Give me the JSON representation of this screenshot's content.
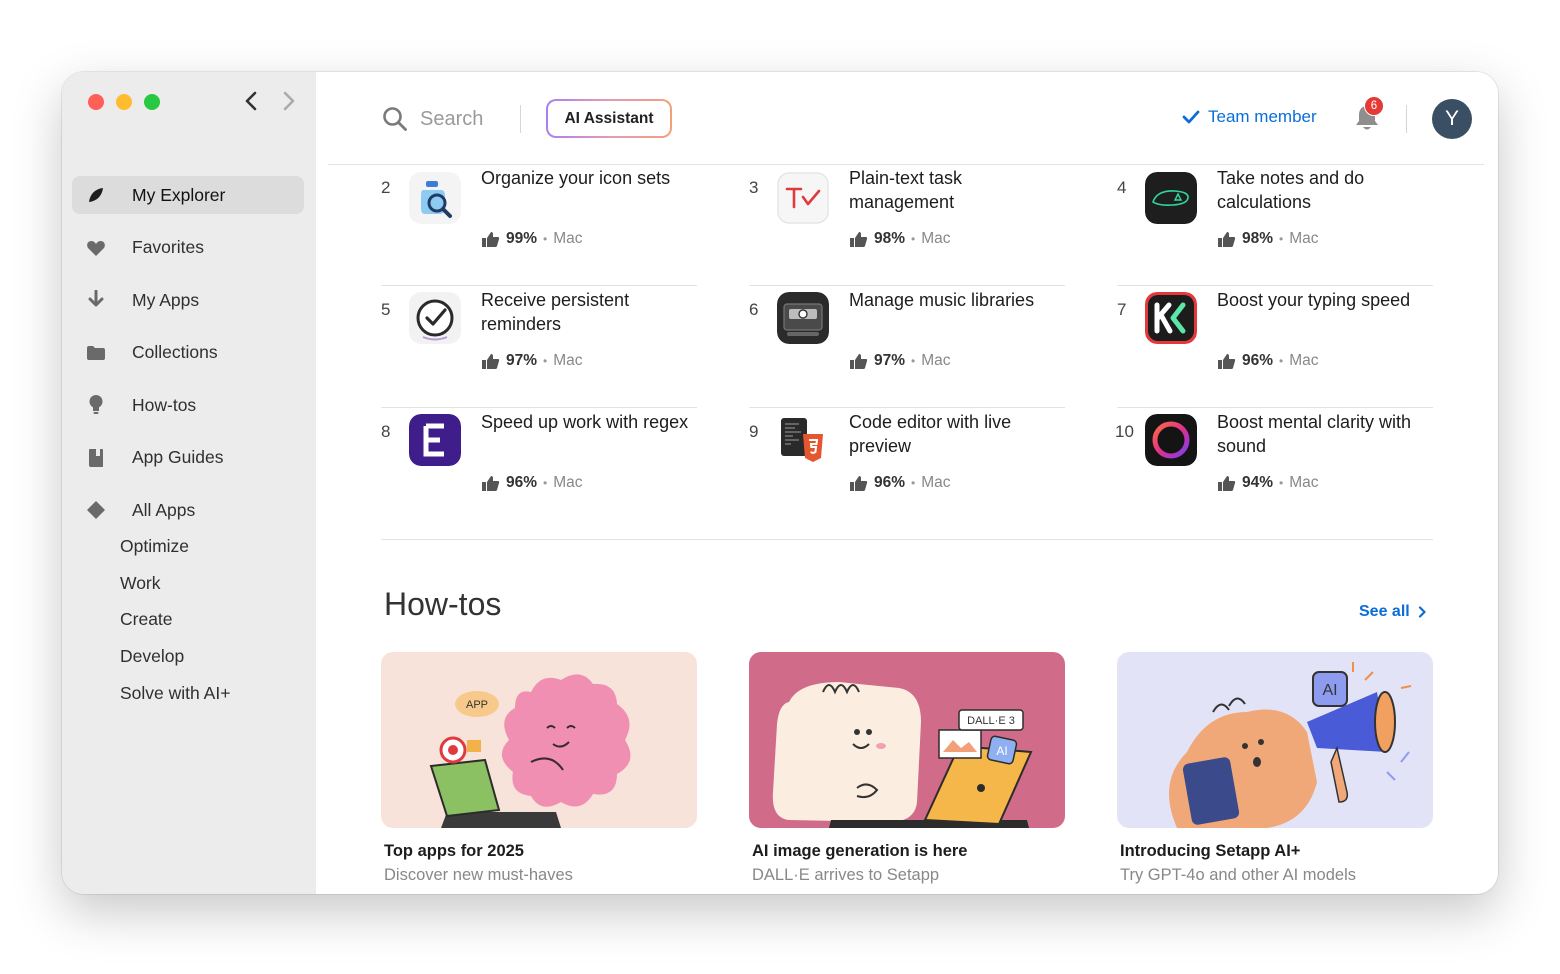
{
  "sidebar": {
    "nav": [
      {
        "label": "My Explorer",
        "icon": "leaf-icon",
        "active": true
      },
      {
        "label": "Favorites",
        "icon": "heart-icon"
      },
      {
        "label": "My Apps",
        "icon": "download-arrow-icon"
      },
      {
        "label": "Collections",
        "icon": "folder-icon"
      },
      {
        "label": "How-tos",
        "icon": "lightbulb-icon"
      },
      {
        "label": "App Guides",
        "icon": "book-icon"
      },
      {
        "label": "All Apps",
        "icon": "diamond-icon"
      }
    ],
    "categories": [
      "Optimize",
      "Work",
      "Create",
      "Develop",
      "Solve with AI+"
    ]
  },
  "topbar": {
    "search_placeholder": "Search",
    "ai_label": "AI Assistant",
    "team_label": "Team member",
    "notification_count": "6",
    "avatar_initial": "Y"
  },
  "apps": [
    {
      "rank": "2",
      "title": "Organize your icon sets",
      "rating": "99%",
      "platform": "Mac",
      "icon": "icon-jar-icon"
    },
    {
      "rank": "3",
      "title": "Plain-text task management",
      "rating": "98%",
      "platform": "Mac",
      "icon": "taskpaper-icon"
    },
    {
      "rank": "4",
      "title": "Take notes and do calculations",
      "rating": "98%",
      "platform": "Mac",
      "icon": "notes-calc-icon"
    },
    {
      "rank": "5",
      "title": "Receive persistent reminders",
      "rating": "97%",
      "platform": "Mac",
      "icon": "checkmark-clock-icon"
    },
    {
      "rank": "6",
      "title": "Manage music libraries",
      "rating": "97%",
      "platform": "Mac",
      "icon": "cassette-icon"
    },
    {
      "rank": "7",
      "title": "Boost your typing speed",
      "rating": "96%",
      "platform": "Mac",
      "icon": "typing-k-icon"
    },
    {
      "rank": "8",
      "title": "Speed up work with regex",
      "rating": "96%",
      "platform": "Mac",
      "icon": "expressions-e-icon"
    },
    {
      "rank": "9",
      "title": "Code editor with live preview",
      "rating": "96%",
      "platform": "Mac",
      "icon": "html5-editor-icon"
    },
    {
      "rank": "10",
      "title": "Boost mental clarity with sound",
      "rating": "94%",
      "platform": "Mac",
      "icon": "sound-ring-icon"
    }
  ],
  "howtos": {
    "title": "How-tos",
    "see_all": "See all",
    "cards": [
      {
        "title": "Top apps for 2025",
        "subtitle": "Discover new must-haves",
        "tag": "APP"
      },
      {
        "title": "AI image generation is here",
        "subtitle": "DALL·E arrives to Setapp",
        "tag": "DALL·E 3",
        "tag2": "AI"
      },
      {
        "title": "Introducing Setapp AI+",
        "subtitle": "Try GPT-4o and other AI models",
        "tag": "AI"
      }
    ]
  },
  "colors": {
    "accent": "#0a6dd8",
    "sidebar_bg": "#ececec",
    "card1_bg": "#f7e3da",
    "card2_bg": "#d06b8a",
    "card3_bg": "#e3e3f8"
  }
}
